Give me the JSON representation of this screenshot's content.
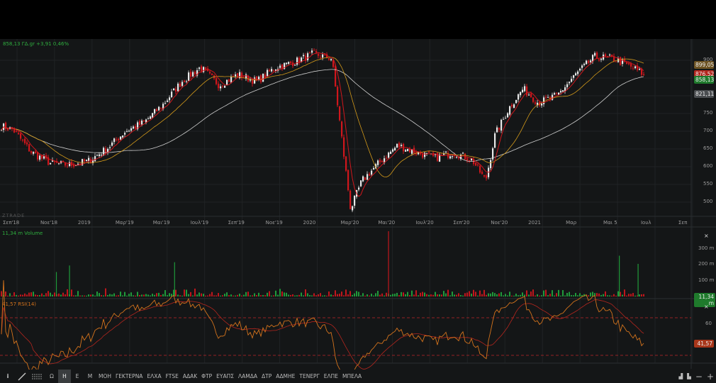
{
  "header": {
    "quote": "858,13 ΓΔ.gr +3,91 0,46%",
    "watermark": "ZTRADE"
  },
  "price_axis": {
    "ticks": [
      "900",
      "850",
      "800",
      "750",
      "700",
      "650",
      "600",
      "550",
      "500"
    ],
    "tags": [
      {
        "value": "899,05",
        "color": "#6e5424"
      },
      {
        "value": "876,52",
        "color": "#b3261e"
      },
      {
        "value": "858,13",
        "color": "#1f7a2c"
      },
      {
        "value": "821,11",
        "color": "#4a4d50"
      }
    ]
  },
  "time_axis": [
    "Σεπ'18",
    "Νοε'18",
    "2019",
    "Μαρ'19",
    "Μαι'19",
    "Ιουλ'19",
    "Σεπ'19",
    "Νοε'19",
    "2020",
    "Μαρ'20",
    "Μαι'20",
    "Ιουλ'20",
    "Σεπ'20",
    "Νοε'20",
    "2021",
    "Μαρ",
    "Μαι 5",
    "Ιουλ",
    "Σεπ"
  ],
  "volume": {
    "title": "11,34 m Volume",
    "ticks": [
      "300 m",
      "200 m",
      "100 m"
    ],
    "current": "11,34 m",
    "close": "×"
  },
  "rsi": {
    "title": "41,57 RSI(14)",
    "ticks": [
      "60"
    ],
    "current": "41,57",
    "close": "×"
  },
  "toolbar": {
    "items": [
      "Ω",
      "Η",
      "Ε",
      "Μ",
      "ΜΟΗ",
      "ΓΕΚΤΕΡΝΑ",
      "ΕΛΧΑ",
      "FTSE",
      "ΑΔΑΚ",
      "ΦΤΡ",
      "ΕΥΑΠΣ",
      "ΛΑΜΔΑ",
      "ΔΤΡ",
      "ΑΔΜΗΕ",
      "ΤΕΝΕΡΓ",
      "ΕΛΠΕ",
      "ΜΠΕΛΑ"
    ],
    "active": "Η"
  },
  "colors": {
    "up": "#e8e8e8",
    "down": "#d0161c",
    "ma_fast": "#d0161c",
    "ma_mid": "#d49a1a",
    "ma_slow": "#cfcfcf",
    "rsi": "#d4731c",
    "vol_up": "#1f9a3a",
    "vol_down": "#c0161c"
  },
  "chart_data": {
    "type": "candlestick",
    "x_unit": "month index (0 = Aug 2018)",
    "anchors": [
      [
        0,
        720
      ],
      [
        1,
        705
      ],
      [
        2,
        640
      ],
      [
        3,
        610
      ],
      [
        4,
        605
      ],
      [
        5,
        615
      ],
      [
        6,
        650
      ],
      [
        7,
        700
      ],
      [
        8,
        725
      ],
      [
        9,
        775
      ],
      [
        10,
        840
      ],
      [
        11,
        880
      ],
      [
        12,
        830
      ],
      [
        13,
        860
      ],
      [
        14,
        840
      ],
      [
        15,
        880
      ],
      [
        16,
        895
      ],
      [
        17,
        918
      ],
      [
        18,
        905
      ],
      [
        19,
        480
      ],
      [
        19.6,
        560
      ],
      [
        20.5,
        610
      ],
      [
        21.5,
        660
      ],
      [
        22.5,
        640
      ],
      [
        23.5,
        625
      ],
      [
        24.5,
        640
      ],
      [
        25.5,
        618
      ],
      [
        26.2,
        560
      ],
      [
        26.7,
        690
      ],
      [
        27.5,
        770
      ],
      [
        28.2,
        820
      ],
      [
        29,
        780
      ],
      [
        30,
        800
      ],
      [
        31,
        860
      ],
      [
        32,
        910
      ],
      [
        33,
        905
      ],
      [
        34,
        880
      ],
      [
        34.7,
        858
      ]
    ],
    "volume_spikes": [
      [
        3.4,
        150
      ],
      [
        4.1,
        190
      ],
      [
        9.7,
        210
      ],
      [
        21.1,
        400
      ],
      [
        33.4,
        250
      ],
      [
        34.4,
        200
      ]
    ],
    "ylim": [
      470,
      930
    ],
    "volume_ylim": [
      0,
      400
    ],
    "rsi_levels": [
      70,
      30
    ],
    "last": {
      "close": 858.13,
      "ma_fast": 876.52,
      "ma_mid": 899.05,
      "ma_slow": 821.11,
      "rsi": 41.57,
      "volume_m": 11.34
    }
  }
}
